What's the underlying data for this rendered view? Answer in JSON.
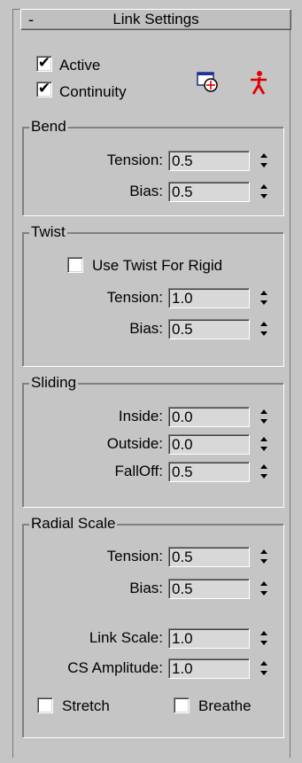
{
  "rollout": {
    "collapse_symbol": "-",
    "title": "Link Settings"
  },
  "toggles": {
    "active": {
      "label": "Active",
      "checked": true
    },
    "continuity": {
      "label": "Continuity",
      "checked": true
    }
  },
  "icons": {
    "pick_link": "window-target-icon",
    "figure": "running-figure-icon"
  },
  "bend": {
    "title": "Bend",
    "tension": {
      "label": "Tension:",
      "value": "0.5"
    },
    "bias": {
      "label": "Bias:",
      "value": "0.5"
    }
  },
  "twist": {
    "title": "Twist",
    "use_twist": {
      "label": "Use Twist For Rigid",
      "checked": false
    },
    "tension": {
      "label": "Tension:",
      "value": "1.0"
    },
    "bias": {
      "label": "Bias:",
      "value": "0.5"
    }
  },
  "sliding": {
    "title": "Sliding",
    "inside": {
      "label": "Inside:",
      "value": "0.0"
    },
    "outside": {
      "label": "Outside:",
      "value": "0.0"
    },
    "falloff": {
      "label": "FallOff:",
      "value": "0.5"
    }
  },
  "radial_scale": {
    "title": "Radial Scale",
    "tension": {
      "label": "Tension:",
      "value": "0.5"
    },
    "bias": {
      "label": "Bias:",
      "value": "0.5"
    },
    "link_scale": {
      "label": "Link Scale:",
      "value": "1.0"
    },
    "cs_amplitude": {
      "label": "CS Amplitude:",
      "value": "1.0"
    },
    "stretch": {
      "label": "Stretch",
      "checked": false
    },
    "breathe": {
      "label": "Breathe",
      "checked": false
    }
  },
  "colors": {
    "panel": "#c5c5c5",
    "field": "#d8d8d8",
    "figure_red": "#e00000"
  }
}
